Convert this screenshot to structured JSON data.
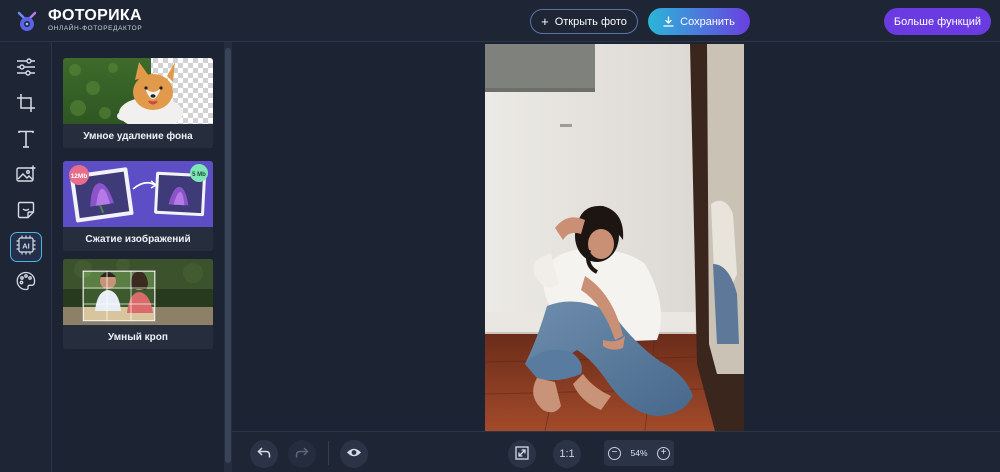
{
  "header": {
    "logo_title": "ФОТОРИКА",
    "logo_subtitle": "ОНЛАЙН-ФОТОРЕДАКТОР",
    "open_photo": "Открыть фото",
    "save": "Сохранить",
    "more_features": "Больше функций"
  },
  "tools": [
    {
      "name": "adjustments-icon"
    },
    {
      "name": "crop-icon"
    },
    {
      "name": "text-icon"
    },
    {
      "name": "image-add-icon"
    },
    {
      "name": "sticker-icon"
    },
    {
      "name": "ai-chip-icon",
      "active": true
    },
    {
      "name": "palette-icon"
    }
  ],
  "panel": {
    "cards": [
      {
        "label": "Умное удаление фона"
      },
      {
        "label": "Сжатие изображений",
        "badge_before": "12Mb",
        "badge_after": "5 Mb"
      },
      {
        "label": "Умный кроп"
      }
    ]
  },
  "canvas": {
    "photo_caption": ""
  },
  "bottom": {
    "fit_label": "",
    "ratio_label": "1:1",
    "zoom_value": "54%",
    "zoom_minus": "−",
    "zoom_plus": "+"
  },
  "colors": {
    "accent_purple": "#6a3be0",
    "accent_cyan": "#2bb6d8",
    "bg": "#1c2333"
  }
}
